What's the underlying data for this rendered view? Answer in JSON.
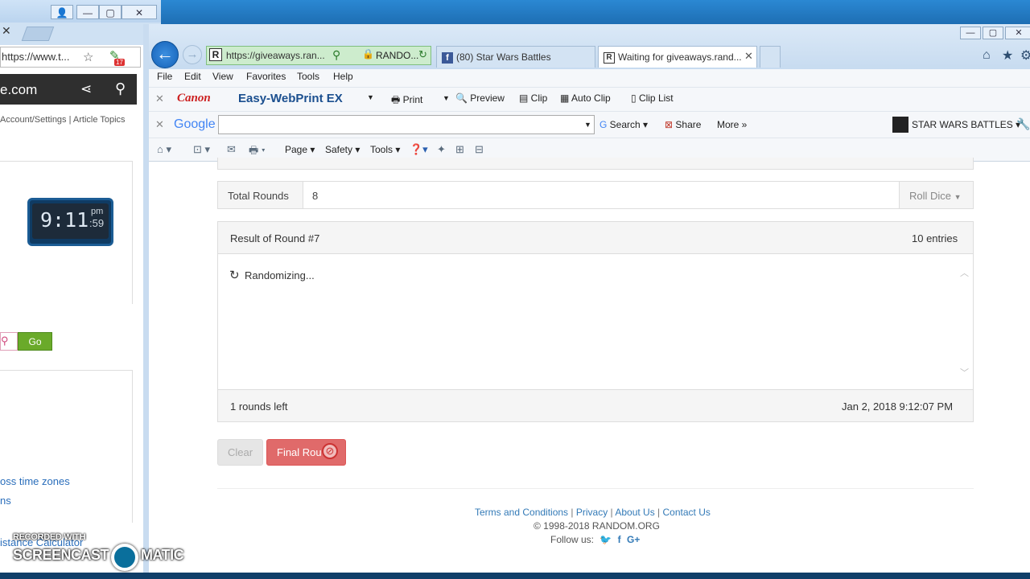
{
  "background_window": {
    "url": "https://www.t...",
    "site": "e.com",
    "top_links": "Account/Settings  |  Article Topics",
    "clock": {
      "time": "9:11",
      "ampm": "pm",
      "seconds": ":59"
    },
    "go_label": "Go",
    "link1": "oss time zones",
    "link2": "ns",
    "link3": "istance Calculator",
    "ext_badge": "17"
  },
  "watermark": {
    "line1": "RECORDED WITH",
    "line2": "SCREENCAST",
    "line3": "MATIC"
  },
  "browser": {
    "address_url": "https://giveaways.ran...",
    "cert_label": "RANDO...",
    "tabs": [
      {
        "label": "(80) Star Wars Battles"
      },
      {
        "label": "Waiting for giveaways.rand..."
      }
    ],
    "menu": [
      "File",
      "Edit",
      "View",
      "Favorites",
      "Tools",
      "Help"
    ],
    "canon_toolbar": {
      "logo": "Canon",
      "product": "Easy-WebPrint EX",
      "print": "Print",
      "preview": "Preview",
      "clip": "Clip",
      "auto_clip": "Auto Clip",
      "clip_list": "Clip List"
    },
    "google_toolbar": {
      "logo": "Google",
      "search": "Search",
      "share": "Share",
      "more": "More",
      "profile": "STAR WARS BATTLES"
    },
    "command_bar": {
      "page": "Page",
      "safety": "Safety",
      "tools": "Tools"
    }
  },
  "page": {
    "total_rounds_label": "Total Rounds",
    "total_rounds_value": "8",
    "roll_dice": "Roll Dice",
    "result_title": "Result of Round #7",
    "entries": "10 entries",
    "randomizing": "Randomizing...",
    "rounds_left": "1 rounds left",
    "timestamp": "Jan 2, 2018 9:12:07 PM",
    "clear_label": "Clear",
    "final_label": "Final Rou",
    "footer": {
      "terms": "Terms and Conditions",
      "privacy": "Privacy",
      "about": "About Us",
      "contact": "Contact Us",
      "copyright": "© 1998-2018 RANDOM.ORG",
      "follow": "Follow us:"
    }
  }
}
